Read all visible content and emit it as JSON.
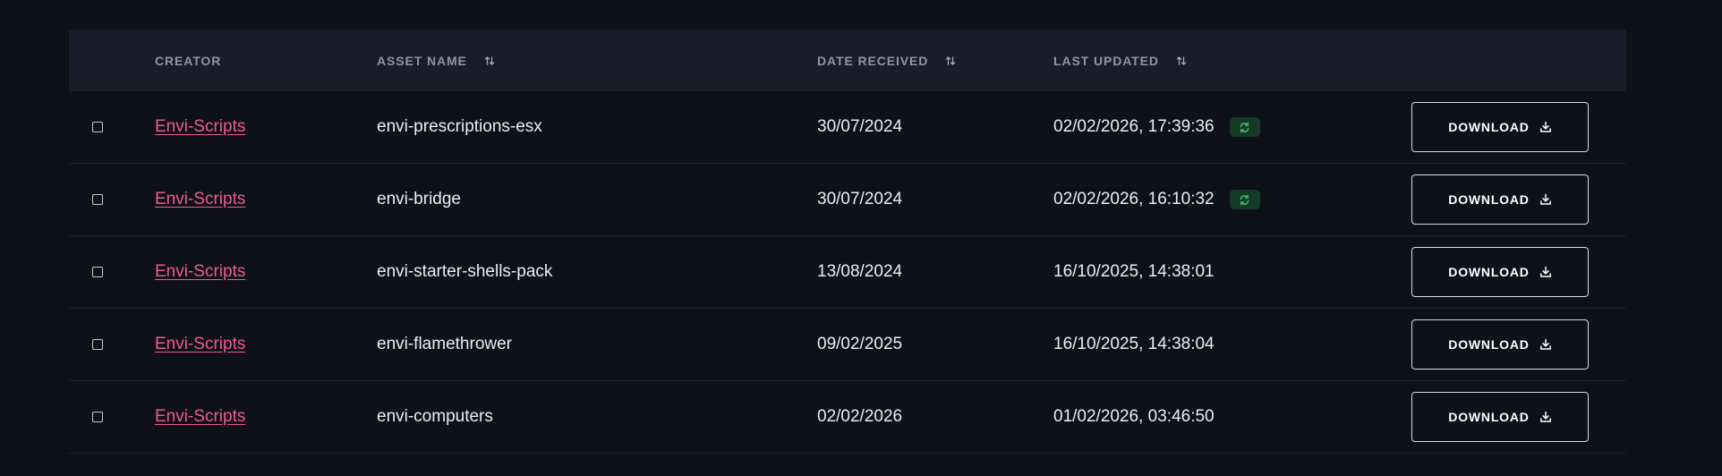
{
  "table": {
    "headers": {
      "creator": "CREATOR",
      "asset_name": "ASSET NAME",
      "date_received": "DATE RECEIVED",
      "last_updated": "LAST UPDATED"
    },
    "download_label": "DOWNLOAD",
    "rows": [
      {
        "creator": "Envi-Scripts",
        "asset_name": "envi-prescriptions-esx",
        "date_received": "30/07/2024",
        "last_updated": "02/02/2026, 17:39:36",
        "has_update_badge": true,
        "checked": false
      },
      {
        "creator": "Envi-Scripts",
        "asset_name": "envi-bridge",
        "date_received": "30/07/2024",
        "last_updated": "02/02/2026, 16:10:32",
        "has_update_badge": true,
        "checked": false
      },
      {
        "creator": "Envi-Scripts",
        "asset_name": "envi-starter-shells-pack",
        "date_received": "13/08/2024",
        "last_updated": "16/10/2025, 14:38:01",
        "has_update_badge": false,
        "checked": false
      },
      {
        "creator": "Envi-Scripts",
        "asset_name": "envi-flamethrower",
        "date_received": "09/02/2025",
        "last_updated": "16/10/2025, 14:38:04",
        "has_update_badge": false,
        "checked": false
      },
      {
        "creator": "Envi-Scripts",
        "asset_name": "envi-computers",
        "date_received": "02/02/2026",
        "last_updated": "01/02/2026, 03:46:50",
        "has_update_badge": false,
        "checked": false
      }
    ]
  },
  "colors": {
    "background": "#0f1118",
    "header_background": "#1a1d29",
    "creator_link": "#f0589a",
    "update_badge_background": "#173a26",
    "update_badge_icon": "#39c46a"
  },
  "icons": {
    "sort": "sort-arrows-icon",
    "update_badge": "refresh-icon",
    "download": "download-icon"
  }
}
